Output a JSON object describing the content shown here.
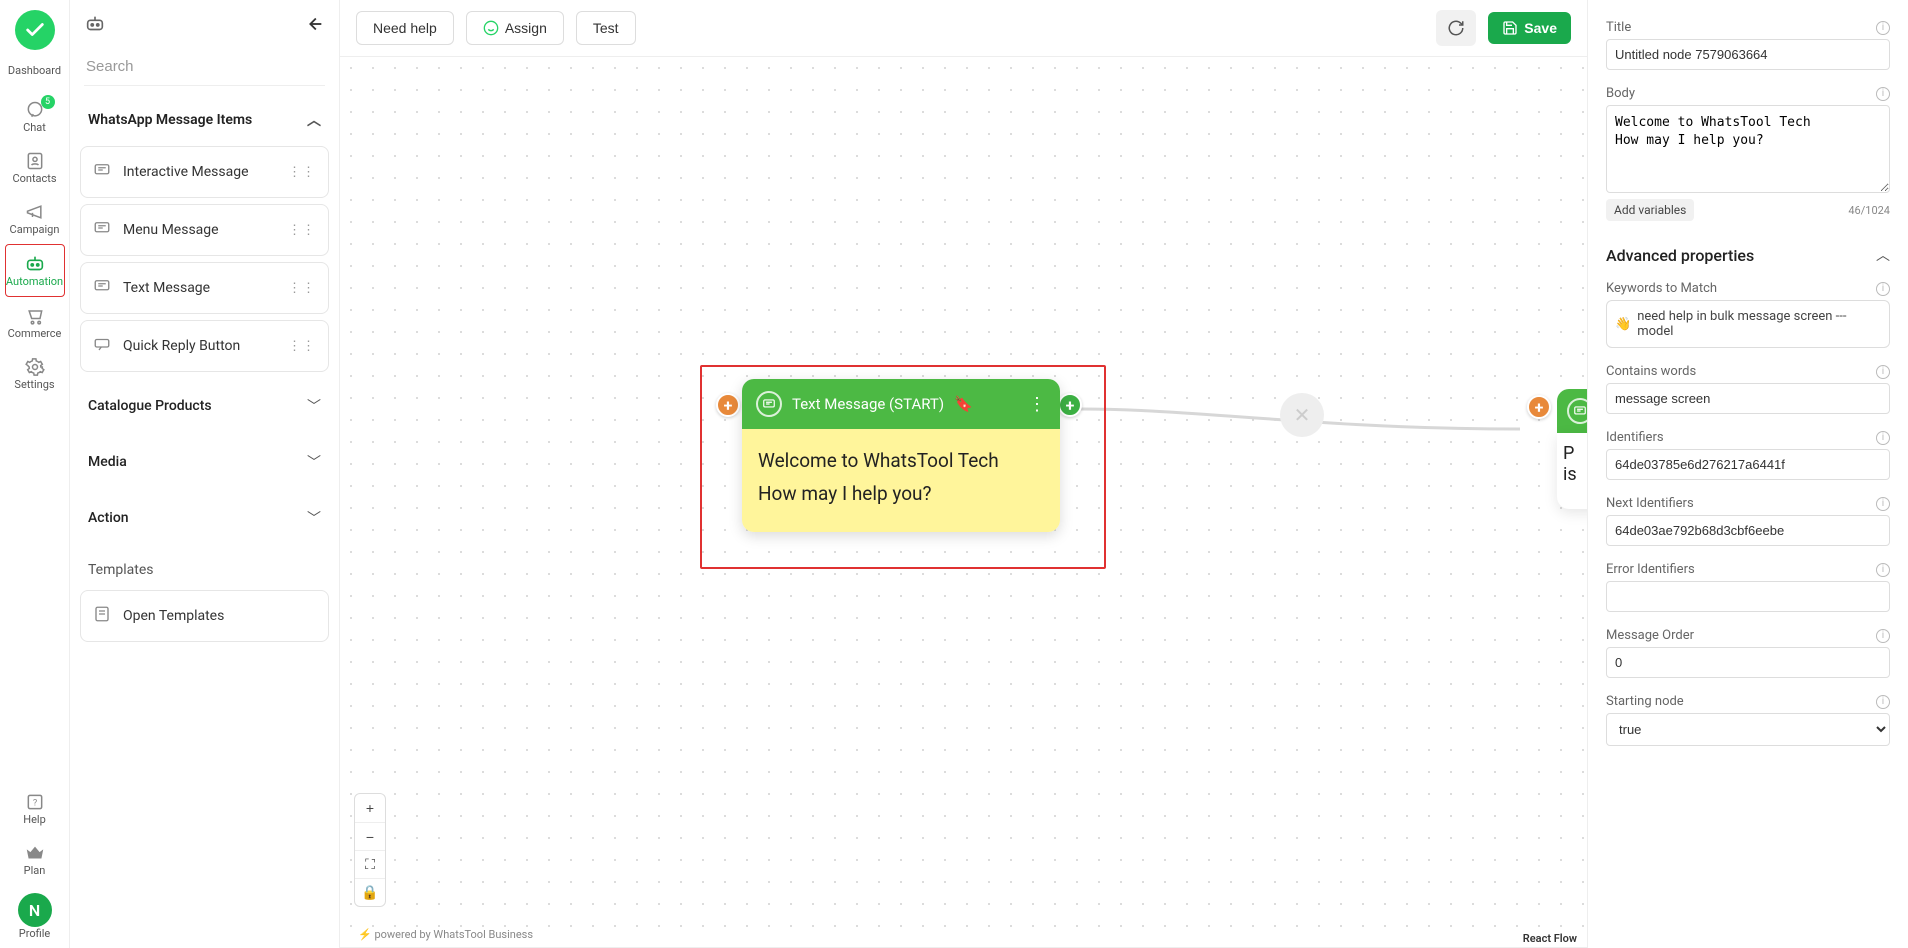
{
  "nav": {
    "items": [
      {
        "key": "dashboard",
        "label": "Dashboard"
      },
      {
        "key": "chat",
        "label": "Chat",
        "badge": "5"
      },
      {
        "key": "contacts",
        "label": "Contacts"
      },
      {
        "key": "campaign",
        "label": "Campaign"
      },
      {
        "key": "automation",
        "label": "Automation"
      },
      {
        "key": "commerce",
        "label": "Commerce"
      },
      {
        "key": "settings",
        "label": "Settings"
      }
    ],
    "bottom": [
      {
        "key": "help",
        "label": "Help"
      },
      {
        "key": "plan",
        "label": "Plan"
      },
      {
        "key": "profile",
        "label": "Profile",
        "avatar": "N"
      }
    ]
  },
  "sidePanel": {
    "searchPlaceholder": "Search",
    "section1": {
      "title": "WhatsApp Message Items",
      "items": [
        {
          "label": "Interactive Message"
        },
        {
          "label": "Menu Message"
        },
        {
          "label": "Text Message"
        },
        {
          "label": "Quick Reply Button"
        }
      ]
    },
    "accordions": [
      {
        "label": "Catalogue Products"
      },
      {
        "label": "Media"
      },
      {
        "label": "Action"
      }
    ],
    "templatesLabel": "Templates",
    "openTemplates": "Open Templates"
  },
  "toolbar": {
    "needHelp": "Need help",
    "assign": "Assign",
    "test": "Test",
    "save": "Save"
  },
  "node": {
    "title": "Text Message (START)",
    "body_line1": "Welcome to WhatsTool Tech",
    "body_line2": "How may I help you?"
  },
  "node2": {
    "body_line1": "P",
    "body_line2": "is"
  },
  "canvas": {
    "poweredBy": "powered by WhatsTool Business",
    "reactFlow": "React Flow"
  },
  "props": {
    "titleLabel": "Title",
    "titleValue": "Untitled node 7579063664",
    "bodyLabel": "Body",
    "bodyValue": "Welcome to WhatsTool Tech\nHow may I help you?",
    "addVariables": "Add variables",
    "charCount": "46/1024",
    "advanced": "Advanced properties",
    "keywordsLabel": "Keywords to Match",
    "keywordsValue": "need help in bulk message screen --- model",
    "containsLabel": "Contains words",
    "containsValue": "message screen",
    "identifiersLabel": "Identifiers",
    "identifiersValue": "64de03785e6d276217a6441f",
    "nextIdLabel": "Next Identifiers",
    "nextIdValue": "64de03ae792b68d3cbf6eebe",
    "errorIdLabel": "Error Identifiers",
    "errorIdValue": "",
    "orderLabel": "Message Order",
    "orderValue": "0",
    "startingLabel": "Starting node",
    "startingValue": "true"
  }
}
